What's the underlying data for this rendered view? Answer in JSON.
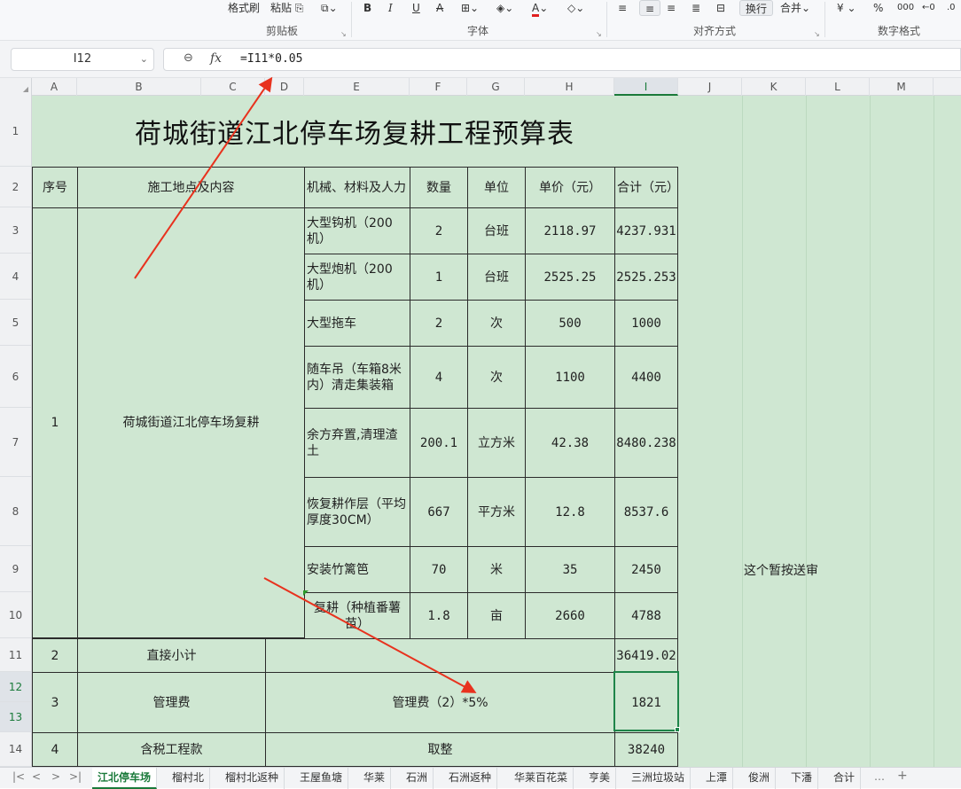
{
  "ribbon": {
    "format_painter": "格式刷",
    "paste": "粘贴",
    "clipboard_label": "剪贴板",
    "font_label": "字体",
    "align_label": "对齐方式",
    "number_label": "数字格式",
    "wrap": "换行",
    "merge": "合并",
    "currency": "¥",
    "percent": "%",
    "font_color": "#e02020"
  },
  "formula_bar": {
    "cell_ref": "I12",
    "formula": "=I11*0.05"
  },
  "columns": [
    "A",
    "B",
    "C",
    "D",
    "E",
    "F",
    "G",
    "H",
    "I",
    "J",
    "K",
    "L",
    "M"
  ],
  "rows": [
    "1",
    "2",
    "3",
    "4",
    "5",
    "6",
    "7",
    "8",
    "9",
    "10",
    "11",
    "12",
    "13",
    "14"
  ],
  "sheet": {
    "title": "荷城街道江北停车场复耕工程预算表",
    "headers": {
      "seq": "序号",
      "location": "施工地点及内容",
      "item": "机械、材料及人力",
      "qty": "数量",
      "unit": "单位",
      "price": "单价（元）",
      "total": "合计（元）"
    },
    "group1_seq": "1",
    "group1_location": "荷城街道江北停车场复耕",
    "items": [
      {
        "item": "大型钩机（200机）",
        "qty": "2",
        "unit": "台班",
        "price": "2118.97",
        "total": "4237.931"
      },
      {
        "item": "大型炮机（200机）",
        "qty": "1",
        "unit": "台班",
        "price": "2525.25",
        "total": "2525.253"
      },
      {
        "item": "大型拖车",
        "qty": "2",
        "unit": "次",
        "price": "500",
        "total": "1000"
      },
      {
        "item": "随车吊（车箱8米内）清走集装箱",
        "qty": "4",
        "unit": "次",
        "price": "1100",
        "total": "4400"
      },
      {
        "item": "余方弃置,清理渣土",
        "qty": "200.1",
        "unit": "立方米",
        "price": "42.38",
        "total": "8480.238"
      },
      {
        "item": "恢复耕作层（平均厚度30CM）",
        "qty": "667",
        "unit": "平方米",
        "price": "12.8",
        "total": "8537.6"
      },
      {
        "item": "安装竹篱笆",
        "qty": "70",
        "unit": "米",
        "price": "35",
        "total": "2450"
      },
      {
        "item": "复耕（种植番薯苗）",
        "qty": "1.8",
        "unit": "亩",
        "price": "2660",
        "total": "4788"
      }
    ],
    "summary": [
      {
        "seq": "2",
        "label": "直接小计",
        "desc": "",
        "total": "36419.02"
      },
      {
        "seq": "3",
        "label": "管理费",
        "desc": "管理费（2）*5%",
        "total": "1821"
      },
      {
        "seq": "4",
        "label": "含税工程款",
        "desc": "取整",
        "total": "38240"
      }
    ],
    "note": "这个暂按送审"
  },
  "tabs": [
    "江北停车场",
    "榴村北",
    "榴村北返种",
    "王屋鱼塘",
    "华莱",
    "石洲",
    "石洲返种",
    "华莱百花菜",
    "亨美",
    "三洲垃圾站",
    "上潭",
    "俊洲",
    "下潘",
    "合计"
  ],
  "tabs_more": "…",
  "tabs_add": "+",
  "colors": {
    "sheet_bg": "#cfe7d2",
    "selection": "#1e8449",
    "annotation_arrow": "#e8321e"
  }
}
